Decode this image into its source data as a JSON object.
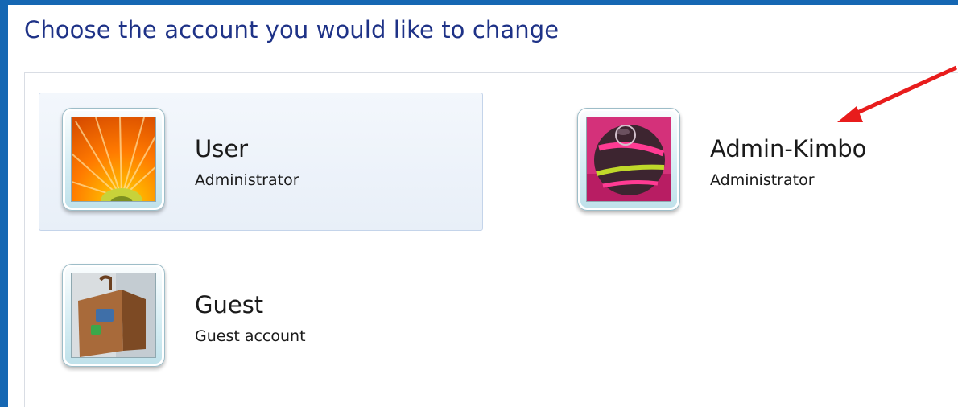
{
  "page": {
    "heading": "Choose the account you would like to change"
  },
  "accounts": [
    {
      "name": "User",
      "role": "Administrator",
      "picture": "orange-flower-picture",
      "selected": true
    },
    {
      "name": "Admin-Kimbo",
      "role": "Administrator",
      "picture": "bowling-ball-picture",
      "selected": false
    },
    {
      "name": "Guest",
      "role": "Guest account",
      "picture": "suitcase-picture",
      "selected": false
    }
  ],
  "annotation": {
    "icon": "red-arrow-icon",
    "color": "#e81c1c"
  },
  "colors": {
    "window_border": "#1567b3",
    "heading": "#1e3287",
    "selection_fill": "#e8eff8"
  }
}
